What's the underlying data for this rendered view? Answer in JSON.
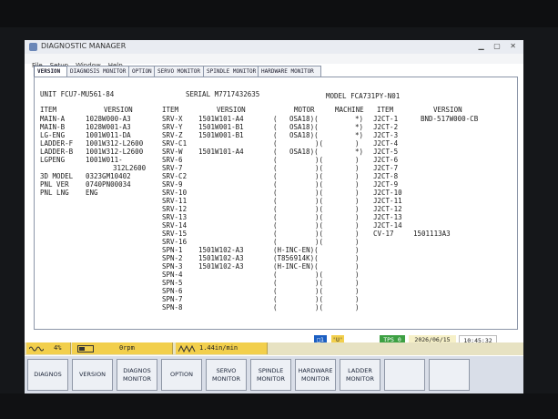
{
  "window": {
    "title": "DIAGNOSTIC MANAGER",
    "menu": [
      "File",
      "Setup",
      "Window",
      "Help"
    ]
  },
  "tabs": [
    "VERSION",
    "DIAGNOSIS MONITOR",
    "OPTION",
    "SERVO MONITOR",
    "SPINDLE MONITOR",
    "HARDWARE MONITOR"
  ],
  "header": {
    "unit": "UNIT FCU7-MU561-84",
    "serial": "SERIAL M7717432635",
    "model": "MODEL FCA731PY-N01"
  },
  "columns": {
    "item1": "ITEM",
    "version1": "VERSION",
    "item2": "ITEM",
    "version2": "VERSION",
    "motor": "MOTOR",
    "machine": "MACHINE",
    "item3": "ITEM",
    "version3": "VERSION"
  },
  "software": [
    {
      "item": "MAIN-A",
      "version": "1028W000-A3"
    },
    {
      "item": "MAIN-B",
      "version": "1028W001-A3"
    },
    {
      "item": "LG-ENG",
      "version": "1001W011-DA"
    },
    {
      "item": "LADDER-F",
      "version": "1001W312-L2600"
    },
    {
      "item": "LADDER-B",
      "version": "1001W312-L2600"
    },
    {
      "item": "LGPENG",
      "version": "1001W011-"
    },
    {
      "item": "",
      "version": "312L2600"
    },
    {
      "item": "3D MODEL",
      "version": "0323GM10402"
    },
    {
      "item": "PNL VER",
      "version": "0740PN00034"
    },
    {
      "item": "PNL LNG",
      "version": "ENG"
    }
  ],
  "servo": [
    {
      "item": "SRV-X",
      "version": "1501W101-A4",
      "motor": "OSA18)(",
      "machine": "*)"
    },
    {
      "item": "SRV-Y",
      "version": "1501W001-B1",
      "motor": "OSA18)(",
      "machine": "*)"
    },
    {
      "item": "SRV-Z",
      "version": "1501W001-B1",
      "motor": "OSA18)(",
      "machine": "*)"
    },
    {
      "item": "SRV-C1",
      "version": "",
      "motor": ")(",
      "machine": ")"
    },
    {
      "item": "SRV-W",
      "version": "1501W101-A4",
      "motor": "OSA18)(",
      "machine": "*)"
    },
    {
      "item": "SRV-6",
      "version": "",
      "motor": ")(",
      "machine": ")"
    },
    {
      "item": "SRV-7",
      "version": "",
      "motor": ")(",
      "machine": ")"
    },
    {
      "item": "SRV-C2",
      "version": "",
      "motor": ")(",
      "machine": ")"
    },
    {
      "item": "SRV-9",
      "version": "",
      "motor": ")(",
      "machine": ")"
    },
    {
      "item": "SRV-10",
      "version": "",
      "motor": ")(",
      "machine": ")"
    },
    {
      "item": "SRV-11",
      "version": "",
      "motor": ")(",
      "machine": ")"
    },
    {
      "item": "SRV-12",
      "version": "",
      "motor": ")(",
      "machine": ")"
    },
    {
      "item": "SRV-13",
      "version": "",
      "motor": ")(",
      "machine": ")"
    },
    {
      "item": "SRV-14",
      "version": "",
      "motor": ")(",
      "machine": ")"
    },
    {
      "item": "SRV-15",
      "version": "",
      "motor": ")(",
      "machine": ")"
    },
    {
      "item": "SRV-16",
      "version": "",
      "motor": ")(",
      "machine": ")"
    },
    {
      "item": "SPN-1",
      "version": "1501W102-A3",
      "motor": "(H-INC-EN)(",
      "machine": ")"
    },
    {
      "item": "SPN-2",
      "version": "1501W102-A3",
      "motor": "(T856914K)(",
      "machine": ")"
    },
    {
      "item": "SPN-3",
      "version": "1501W102-A3",
      "motor": "(H-INC-EN)(",
      "machine": ")"
    },
    {
      "item": "SPN-4",
      "version": "",
      "motor": ")(",
      "machine": ")"
    },
    {
      "item": "SPN-5",
      "version": "",
      "motor": ")(",
      "machine": ")"
    },
    {
      "item": "SPN-6",
      "version": "",
      "motor": ")(",
      "machine": ")"
    },
    {
      "item": "SPN-7",
      "version": "",
      "motor": ")(",
      "machine": ")"
    },
    {
      "item": "SPN-8",
      "version": "",
      "motor": ")(",
      "machine": ")"
    }
  ],
  "hardware": [
    {
      "item": "J2CT-1",
      "version": "BND-517W000-CB"
    },
    {
      "item": "J2CT-2",
      "version": ""
    },
    {
      "item": "J2CT-3",
      "version": ""
    },
    {
      "item": "J2CT-4",
      "version": ""
    },
    {
      "item": "J2CT-5",
      "version": ""
    },
    {
      "item": "J2CT-6",
      "version": ""
    },
    {
      "item": "J2CT-7",
      "version": ""
    },
    {
      "item": "J2CT-8",
      "version": ""
    },
    {
      "item": "J2CT-9",
      "version": ""
    },
    {
      "item": "J2CT-10",
      "version": ""
    },
    {
      "item": "J2CT-11",
      "version": ""
    },
    {
      "item": "J2CT-12",
      "version": ""
    },
    {
      "item": "J2CT-13",
      "version": ""
    },
    {
      "item": "J2CT-14",
      "version": ""
    },
    {
      "item": "CV-17",
      "version": "1501113A3"
    }
  ],
  "status": {
    "indicator1": "□1",
    "indicator2": "'U'",
    "tps": "TPS 0",
    "date": "2026/06/15",
    "time": "10:45:32"
  },
  "meters": {
    "load": "4%",
    "spindle": "0rpm",
    "feed": "1.44in/min"
  },
  "softkeys": [
    {
      "line1": "DIAGNOS",
      "line2": ""
    },
    {
      "line1": "VERSION",
      "line2": ""
    },
    {
      "line1": "DIAGNOS",
      "line2": "MONITOR"
    },
    {
      "line1": "OPTION",
      "line2": ""
    },
    {
      "line1": "SERVO",
      "line2": "MONITOR"
    },
    {
      "line1": "SPINDLE",
      "line2": "MONITOR"
    },
    {
      "line1": "HARDWARE",
      "line2": "MONITOR"
    },
    {
      "line1": "LADDER",
      "line2": "MONITOR"
    },
    {
      "line1": "",
      "line2": ""
    },
    {
      "line1": "",
      "line2": ""
    }
  ],
  "colors": {
    "meter": "#f2cf4c",
    "tps": "#3da043",
    "date_bg": "#f2cf4c",
    "indicator": "#1c5fc2"
  },
  "icons": {
    "load_meter": "wave-icon",
    "spindle_meter": "gauge-icon",
    "feed_meter": "zigzag-icon"
  }
}
